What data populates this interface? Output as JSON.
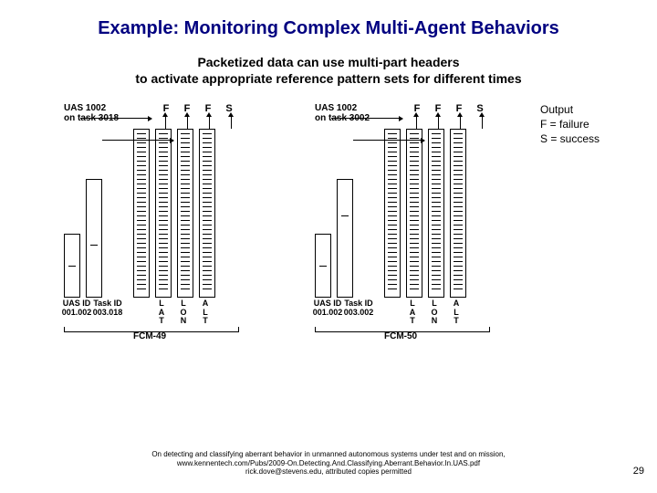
{
  "title": "Example: Monitoring Complex Multi-Agent Behaviors",
  "subtitle_line1": "Packetized data can use multi-part headers",
  "subtitle_line2": "to activate appropriate reference pattern sets for different times",
  "legend": {
    "line1": "Output",
    "line2": "F = failure",
    "line3": "S = success"
  },
  "fcm_left": {
    "header_line1": "UAS 1002",
    "header_line2": "on task 3018",
    "outputs": [
      "F",
      "F",
      "F",
      "S"
    ],
    "col0_l1": "UAS ID",
    "col0_l2": "001.002",
    "col1_l1": "Task ID",
    "col1_l2": "003.018",
    "col2": "L\nA\nT",
    "col3": "L\nO\nN",
    "col4": "A\nL\nT",
    "label": "FCM-49"
  },
  "fcm_right": {
    "header_line1": "UAS 1002",
    "header_line2": "on task 3002",
    "outputs": [
      "F",
      "F",
      "F",
      "S"
    ],
    "col0_l1": "UAS ID",
    "col0_l2": "001.002",
    "col1_l1": "Task ID",
    "col1_l2": "003.002",
    "col2": "L\nA\nT",
    "col3": "L\nO\nN",
    "col4": "A\nL\nT",
    "label": "FCM-50"
  },
  "footer": {
    "line1": "On detecting and classifying aberrant behavior in unmanned autonomous systems under test and on mission,",
    "line2": "www.kennentech.com/Pubs/2009-On.Detecting.And.Classifying.Aberrant.Behavior.In.UAS.pdf",
    "line3": "rick.dove@stevens.edu, attributed copies permitted"
  },
  "page": "29"
}
